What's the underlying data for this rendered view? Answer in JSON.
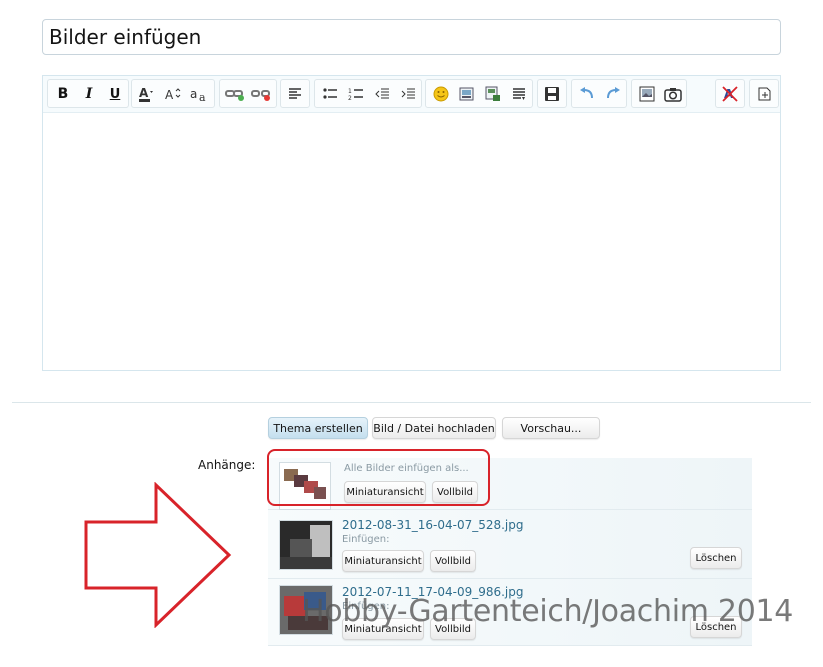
{
  "thread": {
    "title_value": "Bilder einfügen"
  },
  "toolbar": {
    "buttons": [
      "bold-icon",
      "italic-icon",
      "underline-icon",
      "font-color-icon",
      "font-size-icon",
      "font-family-icon",
      "link-icon",
      "unlink-icon",
      "align-left-icon",
      "bulleted-list-icon",
      "numbered-list-icon",
      "outdent-icon",
      "indent-icon",
      "smilie-icon",
      "insert-image-icon",
      "insert-media-icon",
      "more-options-icon",
      "save-draft-icon",
      "undo-icon",
      "redo-icon",
      "insert-gallery-icon",
      "camera-icon",
      "remove-formatting-icon",
      "toggle-bbcode-icon"
    ],
    "bold_glyph": "B",
    "italic_glyph": "I",
    "underline_glyph": "U"
  },
  "actions": {
    "create_thread": "Thema erstellen",
    "upload": "Bild / Datei hochladen",
    "preview": "Vorschau..."
  },
  "attachments": {
    "label": "Anhänge:",
    "insert_all": {
      "text": "Alle Bilder einfügen als...",
      "thumbnail": "Miniaturansicht",
      "full": "Vollbild"
    },
    "items": [
      {
        "filename": "2012-08-31_16-04-07_528.jpg",
        "insert_label": "Einfügen:",
        "thumbnail": "Miniaturansicht",
        "full": "Vollbild",
        "delete": "Löschen"
      },
      {
        "filename": "2012-07-11_17-04-09_986.jpg",
        "insert_label": "Einfügen:",
        "thumbnail": "Miniaturansicht",
        "full": "Vollbild",
        "delete": "Löschen"
      }
    ]
  },
  "annotation": {
    "arrow_color": "#d8232a",
    "highlight_color": "#d8232a"
  },
  "watermark": "Hobby-Gartenteich/Joachim 2014"
}
